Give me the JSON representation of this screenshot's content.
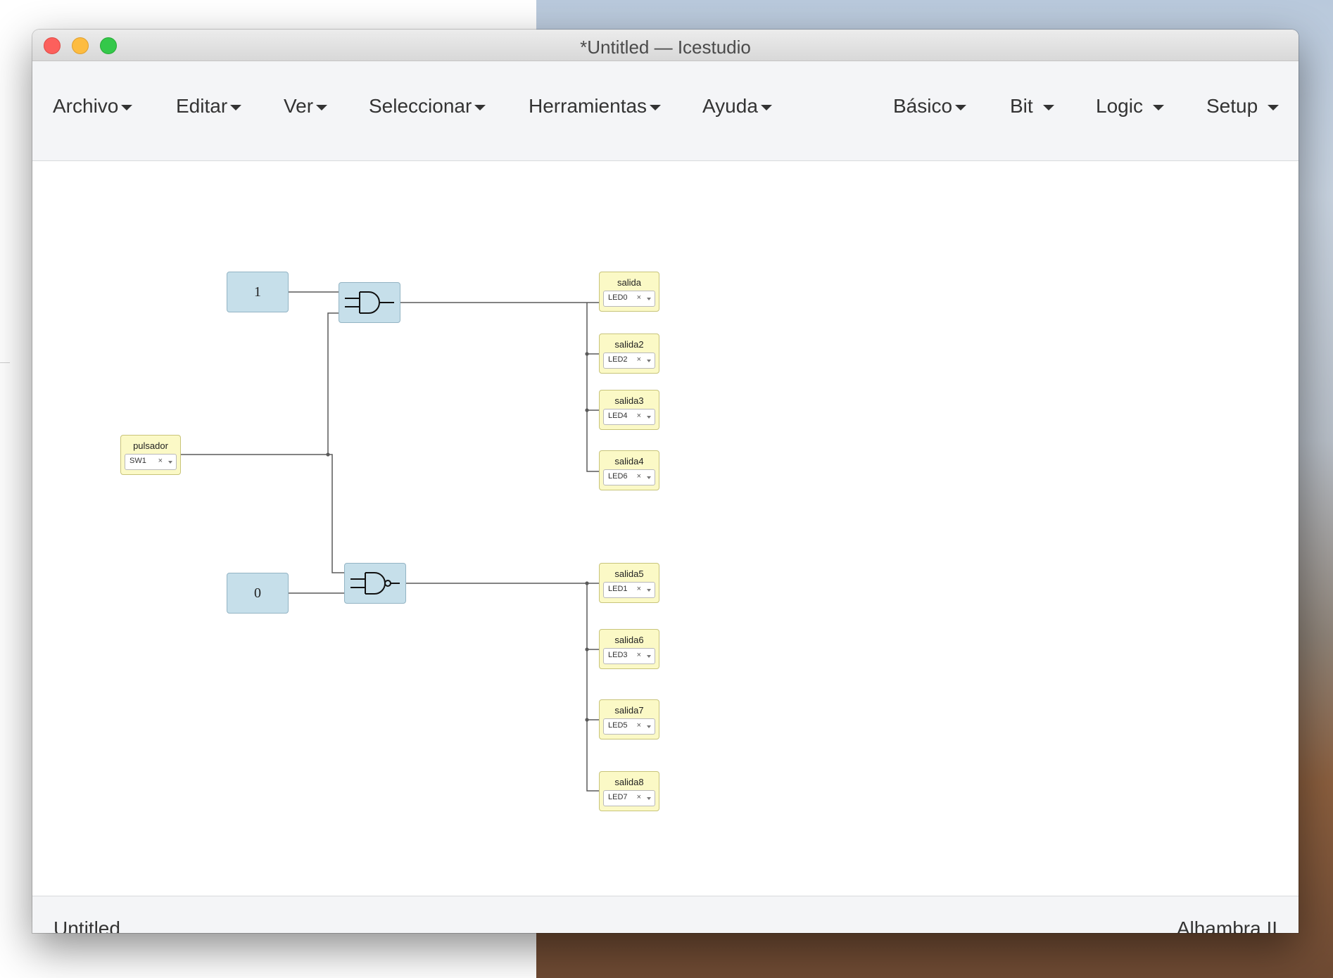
{
  "window": {
    "title": "*Untitled — Icestudio"
  },
  "menubar": {
    "left": [
      "Archivo",
      "Editar",
      "Ver",
      "Seleccionar",
      "Herramientas",
      "Ayuda"
    ],
    "right": [
      "Básico",
      "Bit",
      "Logic",
      "Setup"
    ]
  },
  "canvas": {
    "constants": [
      "1",
      "0"
    ],
    "gates": [
      "and-gate",
      "nand-gate"
    ],
    "input": {
      "name": "pulsador",
      "pin": "SW1",
      "clear": "×"
    },
    "outputs": [
      {
        "name": "salida",
        "pin": "LED0"
      },
      {
        "name": "salida2",
        "pin": "LED2"
      },
      {
        "name": "salida3",
        "pin": "LED4"
      },
      {
        "name": "salida4",
        "pin": "LED6"
      },
      {
        "name": "salida5",
        "pin": "LED1"
      },
      {
        "name": "salida6",
        "pin": "LED3"
      },
      {
        "name": "salida7",
        "pin": "LED5"
      },
      {
        "name": "salida8",
        "pin": "LED7"
      }
    ],
    "clear_symbol": "×"
  },
  "status": {
    "file": "Untitled",
    "board": "Alhambra II"
  }
}
